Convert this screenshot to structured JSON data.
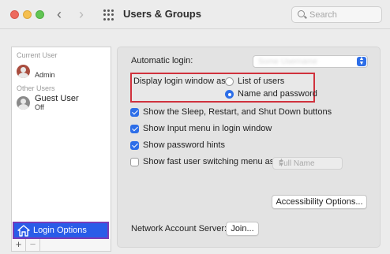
{
  "window": {
    "title": "Users & Groups"
  },
  "search": {
    "placeholder": "Search"
  },
  "sidebar": {
    "current_user_label": "Current User",
    "current_user": {
      "name": "",
      "role": "Admin"
    },
    "other_users_label": "Other Users",
    "other_users": [
      {
        "name": "Guest User",
        "status": "Off"
      }
    ],
    "login_options_label": "Login Options",
    "add_symbol": "+",
    "remove_symbol": "−"
  },
  "main": {
    "automatic_login_label": "Automatic login:",
    "display_login_label": "Display login window as:",
    "display_options": [
      {
        "label": "List of users",
        "selected": false
      },
      {
        "label": "Name and password",
        "selected": true
      }
    ],
    "checkboxes": [
      {
        "label": "Show the Sleep, Restart, and Shut Down buttons",
        "checked": true
      },
      {
        "label": "Show Input menu in login window",
        "checked": true
      },
      {
        "label": "Show password hints",
        "checked": true
      },
      {
        "label": "Show fast user switching menu as",
        "checked": false
      }
    ],
    "fast_switching_value": "Full Name",
    "accessibility_button": "Accessibility Options...",
    "network_server_label": "Network Account Server:",
    "join_button": "Join..."
  },
  "colors": {
    "accent": "#2d6ee8",
    "highlight_box": "#d0323d",
    "selection": "#2a5ce8"
  }
}
